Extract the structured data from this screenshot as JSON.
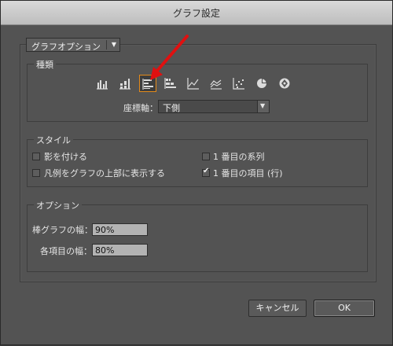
{
  "window": {
    "title": "グラフ設定"
  },
  "top_dropdown": {
    "label": "グラフオプション"
  },
  "type_group": {
    "legend": "種類",
    "icons": [
      {
        "name": "vertical-bar-chart-icon",
        "selected": false
      },
      {
        "name": "stacked-bar-chart-icon",
        "selected": false
      },
      {
        "name": "horizontal-bar-chart-icon",
        "selected": true
      },
      {
        "name": "horizontal-stacked-bar-chart-icon",
        "selected": false
      },
      {
        "name": "line-chart-icon",
        "selected": false
      },
      {
        "name": "area-chart-icon",
        "selected": false
      },
      {
        "name": "scatter-chart-icon",
        "selected": false
      },
      {
        "name": "pie-chart-icon",
        "selected": false
      },
      {
        "name": "radar-chart-icon",
        "selected": false
      }
    ],
    "axis_label": "座標軸：",
    "axis_value": "下側"
  },
  "style_group": {
    "legend": "スタイル",
    "add_shadow": {
      "label": "影を付ける",
      "checked": false
    },
    "legend_top": {
      "label": "凡例をグラフの上部に表示する",
      "checked": false
    },
    "first_row": {
      "label": "1 番目の系列",
      "checked": false
    },
    "first_col": {
      "label": "1 番目の項目 (行)",
      "checked": true
    }
  },
  "options_group": {
    "legend": "オプション",
    "bar_width_label": "棒グラフの幅：",
    "bar_width_value": "90%",
    "cluster_width_label": "各項目の幅：",
    "cluster_width_value": "80%"
  },
  "buttons": {
    "cancel": "キャンセル",
    "ok": "OK"
  },
  "colors": {
    "selection": "#e38a1a",
    "annotation_arrow": "#e01010"
  }
}
